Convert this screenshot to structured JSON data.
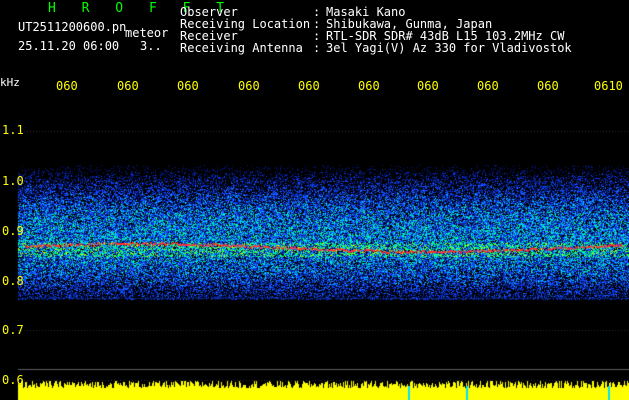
{
  "header": {
    "title": "H R O F F T",
    "file_name": "UT2511200600.pn",
    "mode": "meteor",
    "datetime": "25.11.20 06:00",
    "count": "3.."
  },
  "info": [
    {
      "label": "Observer",
      "value": "Masaki Kano"
    },
    {
      "label": "Receiving Location",
      "value": "Shibukawa, Gunma, Japan"
    },
    {
      "label": "Receiver",
      "value": "RTL-SDR SDR# 43dB L15 103.2MHz CW"
    },
    {
      "label": "Receiving Antenna",
      "value": "3el Yagi(V) Az 330 for Vladivostok"
    }
  ],
  "info_separator": ":",
  "axis": {
    "unit": "kHz",
    "time_ticks": [
      "060",
      "060",
      "060",
      "060",
      "060",
      "060",
      "060",
      "060",
      "060",
      "0610"
    ],
    "freq_ticks": [
      "1.1",
      "1.0",
      "0.9",
      "0.8",
      "0.7",
      "0.6"
    ]
  },
  "colors": {
    "title": "#00ff00",
    "header_text": "#ffffff",
    "tick_text": "#ffff00",
    "axis_text": "#ffffff",
    "noise_floor": "#ffff00",
    "signal_line": "#ff3030",
    "band_blue": "#0b3cff"
  }
}
